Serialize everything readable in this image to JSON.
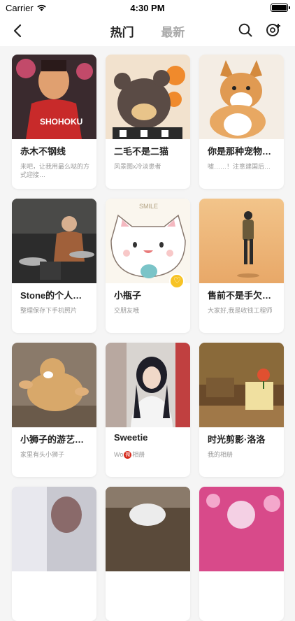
{
  "status_bar": {
    "carrier": "Carrier",
    "time": "4:30 PM"
  },
  "nav": {
    "tab_hot": "热门",
    "tab_new": "最新"
  },
  "cards": [
    {
      "title": "赤木不钢线",
      "desc": "来吧，让我用最么哒的方式迎接…",
      "image": "basketball-anime"
    },
    {
      "title": "二毛不是二猫",
      "desc": "风景图x冷淡患者",
      "image": "bear-cartoon"
    },
    {
      "title": "你是那种宠物…",
      "desc": "嘘……！注意建国后…",
      "image": "corgi"
    },
    {
      "title": "Stone的个人…",
      "desc": "整理保存下手机照片",
      "image": "drummer"
    },
    {
      "title": "小瓶子",
      "desc": "交朋友哦",
      "image": "smile-cat"
    },
    {
      "title": "售前不是手欠…",
      "desc": "大家好,我是收钱工程师",
      "image": "walker"
    },
    {
      "title": "小狮子的游艺…",
      "desc": "家里有头小狮子",
      "image": "lion-cub"
    },
    {
      "title": "Sweetie",
      "desc_pre": "Wo",
      "desc_post": "相册",
      "image": "girl"
    },
    {
      "title": "时光剪影·洛洛",
      "desc": "我的相册",
      "image": "notebook"
    },
    {
      "title": "",
      "desc": "",
      "image": "partial-1"
    },
    {
      "title": "",
      "desc": "",
      "image": "partial-2"
    },
    {
      "title": "",
      "desc": "",
      "image": "partial-3"
    }
  ],
  "colors": {
    "accent": "#f7c325",
    "title": "#222222",
    "muted": "#999999",
    "tab_inactive": "#aaaaaa",
    "weibo_red": "#d52b1e"
  }
}
